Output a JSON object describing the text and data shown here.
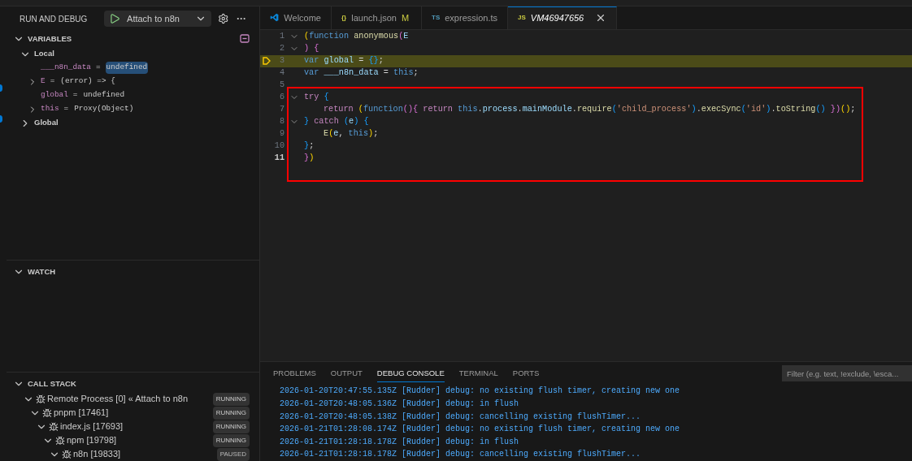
{
  "title_bar": {
    "kind": "strip"
  },
  "sidebar": {
    "title": "RUN AND DEBUG",
    "launch_config": "Attach to n8n",
    "variables": {
      "title": "VARIABLES",
      "expanded": true,
      "scopes": [
        {
          "label": "Local",
          "expanded": true,
          "children": [
            {
              "name": "___n8n_data",
              "operator": "=",
              "value": "undefined",
              "expandable": false,
              "selected": true
            },
            {
              "name": "E",
              "operator": "=",
              "value": "(error) => {",
              "expandable": true,
              "selected": false
            },
            {
              "name": "global",
              "operator": "=",
              "value": "undefined",
              "expandable": false,
              "selected": false
            },
            {
              "name": "this",
              "operator": "=",
              "value": "Proxy(Object)",
              "expandable": true,
              "selected": false
            }
          ]
        },
        {
          "label": "Global",
          "expanded": false
        }
      ]
    },
    "watch": {
      "title": "WATCH",
      "expanded": true
    },
    "call_stack": {
      "title": "CALL STACK",
      "expanded": true,
      "children": [
        {
          "label": "Remote Process [0] « Attach to n8n",
          "status": "RUNNING",
          "expanded": true,
          "children": [
            {
              "label": "pnpm [17461]",
              "status": "RUNNING",
              "expanded": true,
              "children": [
                {
                  "label": "index.js [17693]",
                  "status": "RUNNING",
                  "expanded": true,
                  "children": [
                    {
                      "label": "npm [19798]",
                      "status": "RUNNING",
                      "expanded": true,
                      "children": [
                        {
                          "label": "n8n [19833]",
                          "status": "PAUSED",
                          "expanded": true
                        }
                      ]
                    }
                  ]
                }
              ]
            }
          ]
        }
      ]
    }
  },
  "tabs": [
    {
      "kind": "vscode",
      "label": "Welcome",
      "selected": false
    },
    {
      "kind": "json",
      "icon_text": "{}",
      "label": "launch.json",
      "badge": "M",
      "selected": false
    },
    {
      "kind": "ts",
      "icon_text": "TS",
      "label": "expression.ts",
      "selected": false
    },
    {
      "kind": "js",
      "icon_text": "JS",
      "label": "VM46947656",
      "selected": true
    }
  ],
  "editor": {
    "lines": [
      {
        "number": "1",
        "fold": true,
        "current": false,
        "indented": false,
        "tokens": [
          {
            "kind": "bracket",
            "text": "("
          },
          {
            "kind": "keyword",
            "text": "function "
          },
          {
            "kind": "func",
            "text": "anonymous"
          },
          {
            "kind": "bracket2",
            "text": "("
          },
          {
            "kind": "var",
            "text": "E"
          }
        ]
      },
      {
        "number": "2",
        "fold": true,
        "current": false,
        "indented": false,
        "tokens": [
          {
            "kind": "bracket2",
            "text": ") {"
          }
        ]
      },
      {
        "number": "3",
        "fold": false,
        "current": true,
        "indented": false,
        "tokens": [
          {
            "kind": "keyword",
            "text": "var "
          },
          {
            "kind": "var",
            "text": "global"
          },
          {
            "kind": "plain",
            "text": " = "
          },
          {
            "kind": "bracket3",
            "text": "{}"
          },
          {
            "kind": "plain",
            "text": ";"
          }
        ]
      },
      {
        "number": "4",
        "fold": false,
        "current": false,
        "indented": false,
        "tokens": [
          {
            "kind": "keyword",
            "text": "var "
          },
          {
            "kind": "var",
            "text": "___n8n_data"
          },
          {
            "kind": "plain",
            "text": " = "
          },
          {
            "kind": "keyword",
            "text": "this"
          },
          {
            "kind": "plain",
            "text": ";"
          }
        ]
      },
      {
        "number": "5",
        "fold": false,
        "current": false
      },
      {
        "number": "6",
        "fold": true,
        "current": false,
        "indented": false,
        "tokens": [
          {
            "kind": "control",
            "text": "try "
          },
          {
            "kind": "bracket3",
            "text": "{"
          }
        ]
      },
      {
        "number": "7",
        "fold": false,
        "current": false,
        "indented": true,
        "tokens": [
          {
            "kind": "control",
            "text": "return "
          },
          {
            "kind": "bracket",
            "text": "("
          },
          {
            "kind": "keyword",
            "text": "function"
          },
          {
            "kind": "bracket2",
            "text": "(){"
          },
          {
            "kind": "control",
            "text": " return "
          },
          {
            "kind": "keyword",
            "text": "this"
          },
          {
            "kind": "plain",
            "text": "."
          },
          {
            "kind": "var",
            "text": "process"
          },
          {
            "kind": "plain",
            "text": "."
          },
          {
            "kind": "var",
            "text": "mainModule"
          },
          {
            "kind": "plain",
            "text": "."
          },
          {
            "kind": "func",
            "text": "require"
          },
          {
            "kind": "bracket3",
            "text": "("
          },
          {
            "kind": "string",
            "text": "'child_process'"
          },
          {
            "kind": "bracket3",
            "text": ")"
          },
          {
            "kind": "plain",
            "text": "."
          },
          {
            "kind": "func",
            "text": "execSync"
          },
          {
            "kind": "bracket3",
            "text": "("
          },
          {
            "kind": "string",
            "text": "'id'"
          },
          {
            "kind": "bracket3",
            "text": ")"
          },
          {
            "kind": "plain",
            "text": "."
          },
          {
            "kind": "func",
            "text": "toString"
          },
          {
            "kind": "bracket3",
            "text": "() "
          },
          {
            "kind": "bracket2",
            "text": "})"
          },
          {
            "kind": "bracket",
            "text": "()"
          },
          {
            "kind": "plain",
            "text": ";"
          }
        ]
      },
      {
        "number": "8",
        "fold": true,
        "current": false,
        "indented": false,
        "tokens": [
          {
            "kind": "bracket3",
            "text": "} "
          },
          {
            "kind": "control",
            "text": "catch "
          },
          {
            "kind": "bracket3",
            "text": "("
          },
          {
            "kind": "var",
            "text": "e"
          },
          {
            "kind": "bracket3",
            "text": ") {"
          }
        ]
      },
      {
        "number": "9",
        "fold": false,
        "current": false,
        "indented": true,
        "tokens": [
          {
            "kind": "func",
            "text": "E"
          },
          {
            "kind": "bracket",
            "text": "("
          },
          {
            "kind": "var",
            "text": "e"
          },
          {
            "kind": "plain",
            "text": ", "
          },
          {
            "kind": "keyword",
            "text": "this"
          },
          {
            "kind": "bracket",
            "text": ")"
          },
          {
            "kind": "plain",
            "text": ";"
          }
        ]
      },
      {
        "number": "10",
        "fold": false,
        "current": false,
        "indented": false,
        "tokens": [
          {
            "kind": "bracket3",
            "text": "}"
          },
          {
            "kind": "plain",
            "text": ";"
          }
        ]
      },
      {
        "number": "11",
        "fold": false,
        "current": false,
        "active": true,
        "indented": false,
        "tokens": [
          {
            "kind": "bracket2",
            "text": "}"
          },
          {
            "kind": "bracket",
            "text": ")"
          }
        ]
      }
    ]
  },
  "panel": {
    "tabs": [
      {
        "label": "PROBLEMS",
        "selected": false
      },
      {
        "label": "OUTPUT",
        "selected": false
      },
      {
        "label": "DEBUG CONSOLE",
        "selected": true
      },
      {
        "label": "TERMINAL",
        "selected": false
      },
      {
        "label": "PORTS",
        "selected": false
      }
    ],
    "filter": {
      "placeholder": "Filter (e.g. text, !exclude, \\esca..."
    },
    "lines": [
      "2026-01-20T20:47:55.135Z [Rudder] debug: no existing flush timer, creating new one",
      "2026-01-20T20:48:05.136Z [Rudder] debug: in flush",
      "2026-01-20T20:48:05.138Z [Rudder] debug: cancelling existing flushTimer...",
      "2026-01-21T01:28:08.174Z [Rudder] debug: no existing flush timer, creating new one",
      "2026-01-21T01:28:18.178Z [Rudder] debug: in flush",
      "2026-01-21T01:28:18.178Z [Rudder] debug: cancelling existing flushTimer..."
    ]
  }
}
